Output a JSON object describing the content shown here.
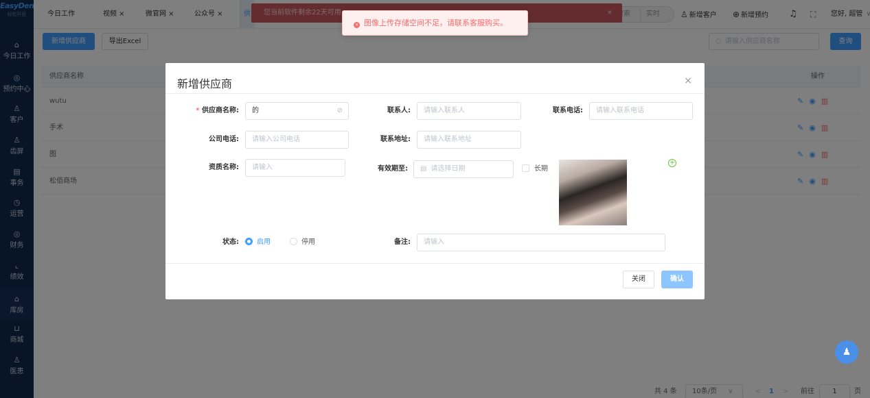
{
  "sidebar": {
    "logo": "EasyDent",
    "logo_sub": "轻松开医",
    "items": [
      {
        "label": "今日工作",
        "icon": "home-icon",
        "glyph": "⌂"
      },
      {
        "label": "预约中心",
        "icon": "calendar-icon",
        "glyph": "◎"
      },
      {
        "label": "客户",
        "icon": "user-icon",
        "glyph": "♙"
      },
      {
        "label": "齿屏",
        "icon": "tooth-user-icon",
        "glyph": "♙"
      },
      {
        "label": "事务",
        "icon": "document-icon",
        "glyph": "▤"
      },
      {
        "label": "运营",
        "icon": "clock-icon",
        "glyph": "◷"
      },
      {
        "label": "财务",
        "icon": "money-bag-icon",
        "glyph": "◎"
      },
      {
        "label": "绩效",
        "icon": "chart-icon",
        "glyph": "⌞"
      },
      {
        "label": "库房",
        "icon": "warehouse-icon",
        "glyph": "⌂"
      },
      {
        "label": "商城",
        "icon": "cart-icon",
        "glyph": "⊔"
      },
      {
        "label": "医患",
        "icon": "people-icon",
        "glyph": "♙"
      }
    ]
  },
  "tabs": [
    "今日工作",
    "视频 ×",
    "微官网 ×",
    "公众号 ×",
    "供"
  ],
  "warning_banner": "您当前软件剩余22天可用",
  "warning_close": "×",
  "toast": "图像上传存储空间不足，请联系客服购买。",
  "top_search": {
    "a": "搜索",
    "b": "实时"
  },
  "top_actions": {
    "new_customer": "新增客户",
    "new_appointment": "新增预约",
    "greeting": "您好, 超管"
  },
  "toolbar": {
    "add": "新增供应商",
    "export": "导出Excel",
    "search_placeholder": "请输入供应商名称",
    "query": "查询"
  },
  "table": {
    "headers": [
      "供应商名称",
      "操作"
    ],
    "rows": [
      "wutu",
      "手术",
      "图",
      "松佰商场"
    ]
  },
  "dialog": {
    "title": "新增供应商",
    "close": "×",
    "fields": {
      "supplier_name_label": "供应商名称:",
      "supplier_name_value": "的",
      "contact_label": "联系人:",
      "contact_placeholder": "请输入联系人",
      "contact_phone_label": "联系电话:",
      "contact_phone_placeholder": "请输入联系电话",
      "company_phone_label": "公司电话:",
      "company_phone_placeholder": "请输入公司电话",
      "address_label": "联系地址:",
      "address_placeholder": "请输入联系地址",
      "qual_label": "资质名称:",
      "qual_placeholder": "请输入",
      "valid_label": "有效期至:",
      "valid_placeholder": "请选择日期",
      "longterm_label": "长期",
      "status_label": "状态:",
      "status_on": "启用",
      "status_off": "停用",
      "remark_label": "备注:",
      "remark_placeholder": "请输入"
    },
    "cancel": "关闭",
    "confirm": "确认"
  },
  "pagination": {
    "total": "共 4 条",
    "page_size": "10条/页",
    "current": "1",
    "goto": "前往",
    "goto_value": "1",
    "unit": "页"
  },
  "colors": {
    "primary": "#409eff",
    "danger": "#f56c6c",
    "sidebar": "#0e2a4f"
  }
}
